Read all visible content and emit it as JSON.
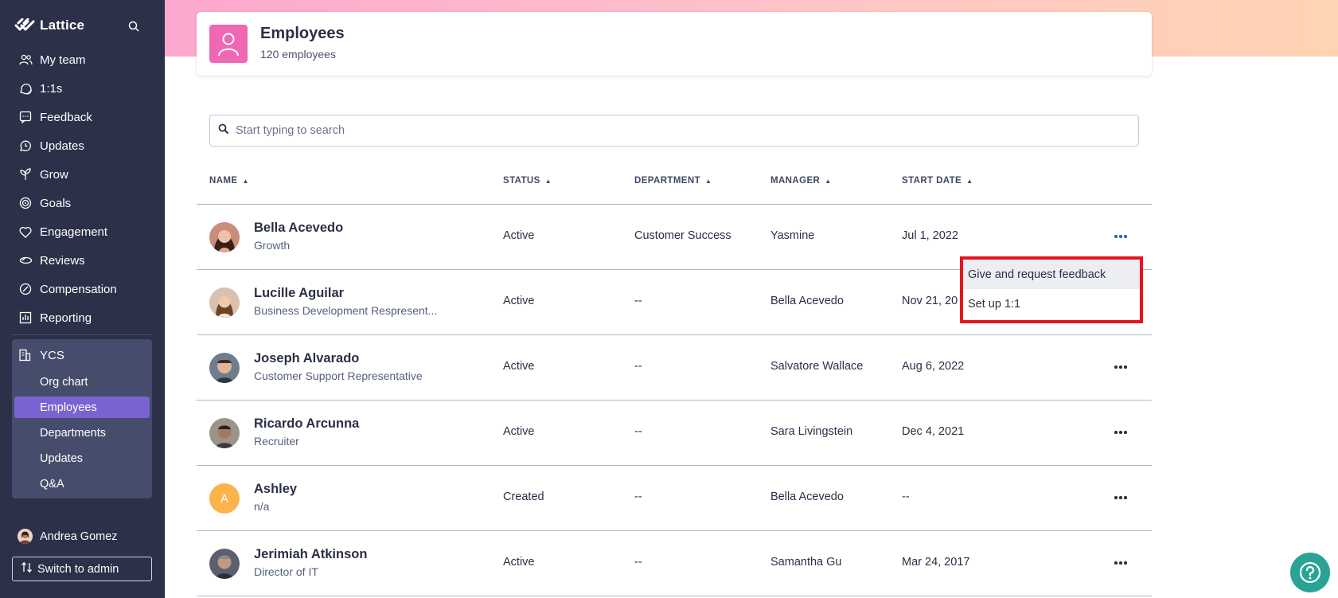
{
  "sidebar": {
    "brand": "Lattice",
    "nav": [
      {
        "label": "My team",
        "icon": "people-icon"
      },
      {
        "label": "1:1s",
        "icon": "chat-bubbles-icon"
      },
      {
        "label": "Feedback",
        "icon": "feedback-icon"
      },
      {
        "label": "Updates",
        "icon": "updates-icon"
      },
      {
        "label": "Grow",
        "icon": "grow-icon"
      },
      {
        "label": "Goals",
        "icon": "target-icon"
      },
      {
        "label": "Engagement",
        "icon": "heart-icon"
      },
      {
        "label": "Reviews",
        "icon": "reviews-icon"
      },
      {
        "label": "Compensation",
        "icon": "compensation-icon"
      },
      {
        "label": "Reporting",
        "icon": "reporting-icon"
      }
    ],
    "company": {
      "label": "YCS",
      "items": [
        "Org chart",
        "Employees",
        "Departments",
        "Updates",
        "Q&A"
      ],
      "active": "Employees"
    },
    "user_name": "Andrea Gomez",
    "switch_label": "Switch to admin"
  },
  "page": {
    "title": "Employees",
    "subtitle": "120 employees"
  },
  "search": {
    "placeholder": "Start typing to search"
  },
  "table": {
    "headers": [
      "NAME",
      "STATUS",
      "DEPARTMENT",
      "MANAGER",
      "START DATE"
    ],
    "rows": [
      {
        "name": "Bella Acevedo",
        "role": "Growth",
        "status": "Active",
        "department": "Customer Success",
        "manager": "Yasmine",
        "start": "Jul 1, 2022"
      },
      {
        "name": "Lucille Aguilar",
        "role": "Business Development Respresent...",
        "status": "Active",
        "department": "--",
        "manager": "Bella Acevedo",
        "start": "Nov 21, 20"
      },
      {
        "name": "Joseph Alvarado",
        "role": "Customer Support Representative",
        "status": "Active",
        "department": "--",
        "manager": "Salvatore Wallace",
        "start": "Aug 6, 2022"
      },
      {
        "name": "Ricardo Arcunna",
        "role": "Recruiter",
        "status": "Active",
        "department": "--",
        "manager": "Sara Livingstein",
        "start": "Dec 4, 2021"
      },
      {
        "name": "Ashley",
        "role": "n/a",
        "status": "Created",
        "department": "--",
        "manager": "Bella Acevedo",
        "start": "--",
        "initial": "A"
      },
      {
        "name": "Jerimiah Atkinson",
        "role": "Director of IT",
        "status": "Active",
        "department": "--",
        "manager": "Samantha Gu",
        "start": "Mar 24, 2017"
      }
    ]
  },
  "row_menu": {
    "items": [
      "Give and request feedback",
      "Set up 1:1"
    ]
  },
  "colors": {
    "sidebar_bg": "#2c3048",
    "active_item": "#7b62d3",
    "highlight_border": "#e8141c",
    "help_button": "#2aa396"
  }
}
